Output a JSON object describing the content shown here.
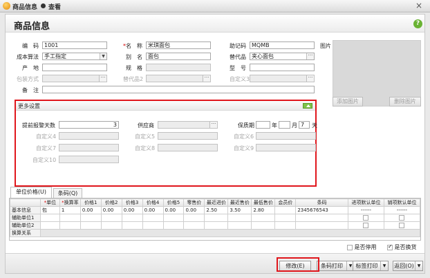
{
  "window": {
    "title1": "商品信息",
    "title2": "查看",
    "close": "×"
  },
  "header": {
    "title": "商品信息",
    "help": "?"
  },
  "form": {
    "code_label": "编　码",
    "code_value": "1001",
    "name_label": "名　称",
    "name_value": "米琪面包",
    "mnemonic_label": "助记码",
    "mnemonic_value": "MQMB",
    "image_label": "图片",
    "cost_label": "成本算法",
    "cost_value": "手工指定",
    "alias_label": "别　名",
    "alias_value": "面包",
    "substitute_label": "替代品",
    "substitute_value": "夹心面包",
    "origin_label": "产　地",
    "spec_label": "规　格",
    "model_label": "型　号",
    "package_label": "包装方式",
    "substitute2_label": "替代品2",
    "custom3_label": "自定义3",
    "remark_label": "备　注",
    "add_image": "添加图片",
    "delete_image": "删除图片"
  },
  "more": {
    "title": "更多设置",
    "warn_days_label": "提前报警天数",
    "warn_days_value": "3",
    "supplier_label": "供应商",
    "shelf_label": "保质期",
    "year": "年",
    "month": "月",
    "month_value": "7",
    "day": "天",
    "custom4": "自定义4",
    "custom5": "自定义5",
    "custom6": "自定义6",
    "custom7": "自定义7",
    "custom8": "自定义8",
    "custom9": "自定义9",
    "custom10": "自定义10"
  },
  "tabs": [
    {
      "label": "单位价格(U)"
    },
    {
      "label": "条码(Q)"
    }
  ],
  "grid": {
    "headers": [
      "",
      "*单位",
      "*换算率",
      "价格1",
      "价格2",
      "价格3",
      "价格4",
      "价格5",
      "零售价",
      "最近进价",
      "最近售价",
      "最低售价",
      "会员价",
      "条码",
      "进项默认单位",
      "销项默认单位"
    ],
    "rows": [
      {
        "name": "基本信息",
        "cells": [
          "包",
          "1",
          "0.00",
          "0.00",
          "0.00",
          "0.00",
          "0.00",
          "0.00",
          "2.50",
          "3.50",
          "2.80",
          "",
          "2345676543",
          "------",
          "------"
        ]
      },
      {
        "name": "辅助单位1",
        "cells": [
          "",
          "",
          "",
          "",
          "",
          "",
          "",
          "",
          "",
          "",
          "",
          "",
          "",
          "",
          ""
        ]
      },
      {
        "name": "辅助单位2",
        "cells": [
          "",
          "",
          "",
          "",
          "",
          "",
          "",
          "",
          "",
          "",
          "",
          "",
          "",
          "",
          ""
        ]
      },
      {
        "name": "换算关系",
        "cells": []
      }
    ]
  },
  "options": {
    "disabled_label": "是否停用",
    "disabled_checked": false,
    "exchange_label": "是否换货",
    "exchange_checked": true
  },
  "footer": {
    "edit": "修改(E)",
    "barcode_print": "条码打印",
    "label_print": "标签打印",
    "back": "返回(O)"
  }
}
